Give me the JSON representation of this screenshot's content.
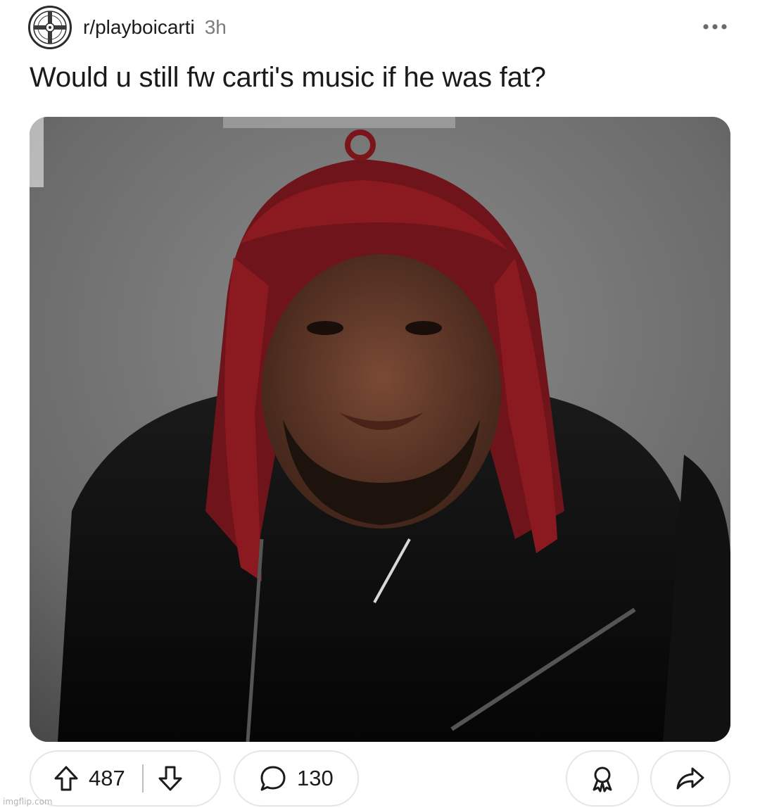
{
  "post": {
    "subreddit": "r/playboicarti",
    "age": "3h",
    "title": "Would u still fw carti's music if he was fat?"
  },
  "media": {
    "description_icon": "photo"
  },
  "actions": {
    "upvotes": "487",
    "comments": "130",
    "icons": {
      "upvote": "arrow-up-icon",
      "downvote": "arrow-down-icon",
      "comment": "speech-bubble-icon",
      "award": "award-ribbon-icon",
      "share": "share-arrow-icon",
      "more": "ellipsis-icon"
    }
  },
  "watermark": "imgflip.com",
  "colors": {
    "text": "#1a1a1b",
    "muted": "#7c7c7c",
    "pill_border": "#e6e6e6",
    "hair": "#8a1a1f"
  }
}
